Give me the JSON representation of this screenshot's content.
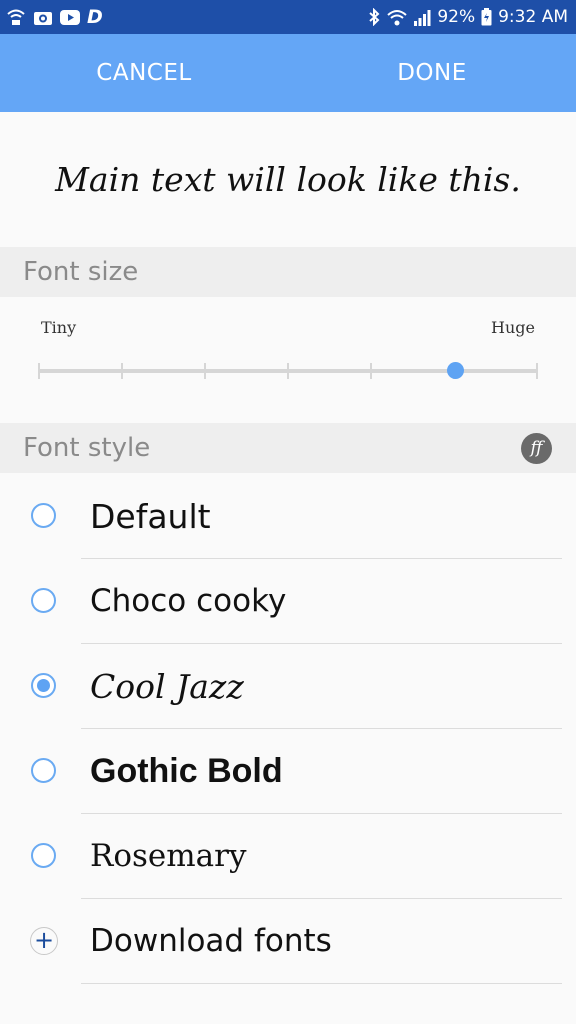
{
  "status_bar": {
    "left_icons": [
      "wifi-calling-icon",
      "camera-icon",
      "youtube-icon",
      "d-app-icon"
    ],
    "d_letter": "D",
    "right_icons": [
      "bluetooth-icon",
      "wifi-icon",
      "signal-icon",
      "battery-icon"
    ],
    "battery": "92%",
    "time": "9:32 AM"
  },
  "action_bar": {
    "cancel_label": "CANCEL",
    "done_label": "DONE",
    "color": "#64a6f6"
  },
  "preview": {
    "text": "Main text will look like this."
  },
  "font_size": {
    "header": "Font size",
    "min_label": "Tiny",
    "max_label": "Huge",
    "steps": 7,
    "selected_step": 6
  },
  "font_style": {
    "header": "Font style",
    "header_icon": "font-ff-icon",
    "header_icon_text": "ff",
    "options": [
      {
        "label": "Default",
        "checked": false
      },
      {
        "label": "Choco cooky",
        "checked": false
      },
      {
        "label": "Cool Jazz",
        "checked": true
      },
      {
        "label": "Gothic Bold",
        "checked": false
      },
      {
        "label": "Rosemary",
        "checked": false
      }
    ],
    "download_label": "Download fonts",
    "download_icon": "plus-icon"
  },
  "colors": {
    "status_bar": "#1e4fa8",
    "accent": "#5ea3f3"
  }
}
